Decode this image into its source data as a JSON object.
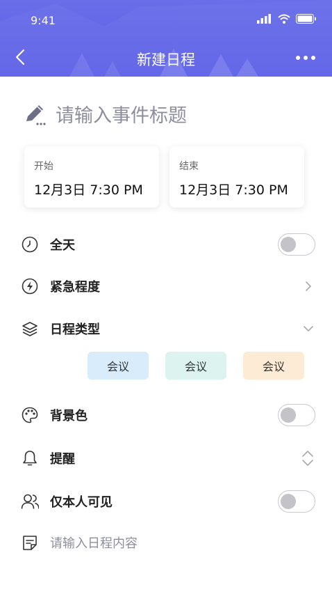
{
  "status_bar": {
    "time": "9:41"
  },
  "header": {
    "title": "新建日程"
  },
  "event_title": {
    "placeholder": "请输入事件标题"
  },
  "start": {
    "label": "开始",
    "value": "12月3日   7:30 PM"
  },
  "end": {
    "label": "结束",
    "value": "12月3日   7:30 PM"
  },
  "rows": {
    "all_day": {
      "label": "全天",
      "enabled": false
    },
    "urgency": {
      "label": "紧急程度"
    },
    "event_type": {
      "label": "日程类型",
      "tags": [
        {
          "label": "会议",
          "color": "#d8ecfb"
        },
        {
          "label": "会议",
          "color": "#dcf3ef"
        },
        {
          "label": "会议",
          "color": "#fdebd6"
        }
      ]
    },
    "background_color": {
      "label": "背景色",
      "enabled": false
    },
    "reminder": {
      "label": "提醒"
    },
    "private": {
      "label": "仅本人可见",
      "enabled": false
    }
  },
  "content": {
    "placeholder": "请输入日程内容"
  },
  "colors": {
    "header": "#6164e6",
    "text": "#222222",
    "muted": "#8e8e9e"
  }
}
